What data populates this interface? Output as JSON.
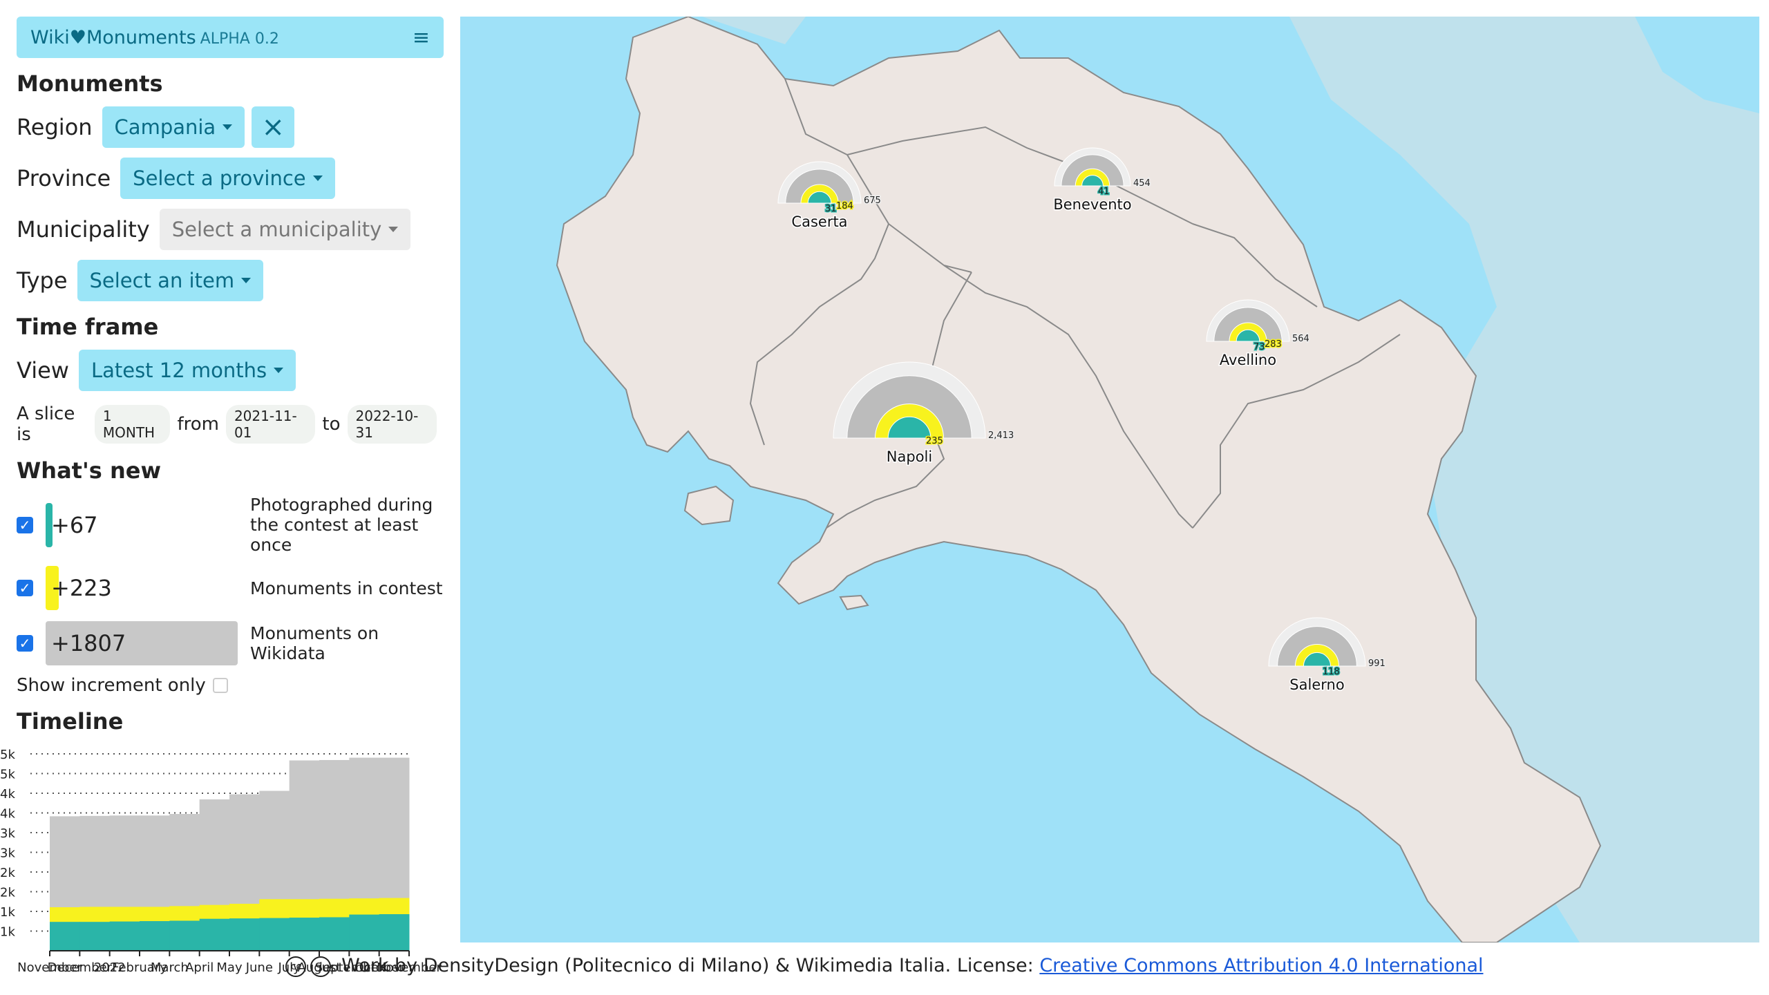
{
  "app": {
    "name": "Wiki♥Monuments",
    "version": "ALPHA 0.2"
  },
  "sidebar": {
    "monuments_heading": "Monuments",
    "region": {
      "label": "Region",
      "value": "Campania"
    },
    "province": {
      "label": "Province",
      "value": "Select a province"
    },
    "municipality": {
      "label": "Municipality",
      "value": "Select a municipality"
    },
    "type": {
      "label": "Type",
      "value": "Select an item"
    },
    "timeframe_heading": "Time frame",
    "view": {
      "label": "View",
      "value": "Latest 12 months"
    },
    "slice": {
      "prefix": "A slice is",
      "unit": "1 MONTH",
      "from_label": "from",
      "from": "2021-11-01",
      "to_label": "to",
      "to": "2022-10-31"
    },
    "whats_new_heading": "What's new",
    "whats_new": [
      {
        "value": "+67",
        "text": "Photographed during the contest at least once",
        "color": "#2ab5a8",
        "fraction": 0.02
      },
      {
        "value": "+223",
        "text": "Monuments in contest",
        "color": "#f8f21e",
        "fraction": 0.07
      },
      {
        "value": "+1807",
        "text": "Monuments on Wikidata",
        "color": "#c8c8c8",
        "fraction": 1.0
      }
    ],
    "increment_label": "Show increment only",
    "timeline_heading": "Timeline"
  },
  "chart_data": {
    "type": "area",
    "title": "Timeline",
    "x": [
      "November",
      "December",
      "2022",
      "February",
      "March",
      "April",
      "May",
      "June",
      "July",
      "August",
      "September",
      "October",
      "November"
    ],
    "y_ticks": [
      "1k",
      "1k",
      "2k",
      "2k",
      "3k",
      "3k",
      "4k",
      "4k",
      "5k",
      "5k"
    ],
    "series": [
      {
        "color": "#2ab5a8",
        "values": [
          750,
          750,
          760,
          770,
          780,
          830,
          840,
          850,
          860,
          870,
          940,
          950
        ]
      },
      {
        "color": "#f8f21e",
        "values": [
          1130,
          1140,
          1140,
          1140,
          1160,
          1190,
          1220,
          1340,
          1340,
          1350,
          1360,
          1370
        ]
      },
      {
        "color": "#c8c8c8",
        "values": [
          3490,
          3500,
          3510,
          3510,
          3550,
          3930,
          4060,
          4150,
          4940,
          4950,
          5010,
          5010
        ]
      }
    ]
  },
  "map": {
    "provinces": [
      {
        "name": "Caserta",
        "teal": "31",
        "yellow": "184",
        "gray": "675"
      },
      {
        "name": "Benevento",
        "teal": "41",
        "yellow": "",
        "gray": "454"
      },
      {
        "name": "Avellino",
        "teal": "73",
        "yellow": "283",
        "gray": "564"
      },
      {
        "name": "Napoli",
        "teal": "",
        "yellow": "235",
        "gray": "2,413"
      },
      {
        "name": "Salerno",
        "teal": "118",
        "yellow": "",
        "gray": "991"
      }
    ]
  },
  "footer": {
    "text": "Work by DensityDesign (Politecnico di Milano) & Wikimedia Italia. License: ",
    "link": "Creative Commons Attribution 4.0 International"
  }
}
